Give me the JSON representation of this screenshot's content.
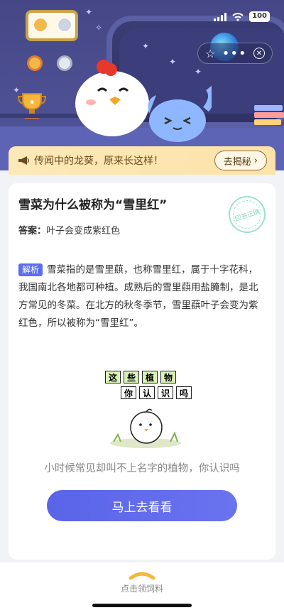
{
  "status": {
    "battery": "100"
  },
  "banner": {
    "text": "传闻中的龙葵，原来长这样！",
    "button": "去揭秘"
  },
  "card": {
    "question": "雪菜为什么被称为“雪里红”",
    "stamp": "回答正确",
    "answer_label": "答案：",
    "answer": "叶子会变成紫红色",
    "tag": "解析",
    "explanation": "雪菜指的是雪里蕻，也称雪里红，属于十字花科，我国南北各地都可种植。成熟后的雪里蕻用盐腌制，是北方常见的冬菜。在北方的秋冬季节，雪里蕻叶子会变为紫红色，所以被称为“雪里红”。",
    "tiles_row1": [
      "这",
      "些",
      "植",
      "物"
    ],
    "tiles_row2": [
      "你",
      "认",
      "识",
      "吗"
    ],
    "description": "小时候常见却叫不上名字的植物，你认识吗",
    "cta": "马上去看看"
  },
  "bottom": {
    "label": "点击领饲料"
  },
  "icons": [
    "medal-icon",
    "trophy-icon",
    "wifi-icon",
    "signal-icon",
    "star-icon",
    "more-icon",
    "close-icon",
    "megaphone-icon",
    "chevron-up-icon"
  ],
  "colors": {
    "accent": "#5b6ef3",
    "banner": "#fbe3a9",
    "hero": "#4f5296"
  }
}
